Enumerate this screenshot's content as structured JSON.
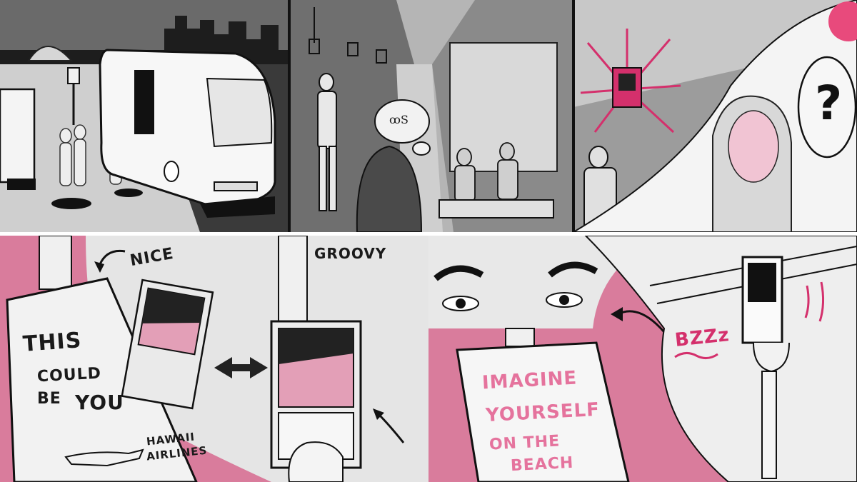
{
  "colors": {
    "accent_pink": "#d4306c",
    "soft_pink": "#e18aa8",
    "ink": "#1a1a1a",
    "light_gray": "#d9d9d9",
    "mid_gray": "#9a9a9a",
    "dark_gray": "#5c5c5c"
  },
  "panels": {
    "bus_stop": {
      "icon": "bus-icon"
    },
    "subway": {
      "thought_doodle": "ꝏS"
    },
    "screen_reveal": {
      "question": "?"
    },
    "hawaii_ad": {
      "line1": "THIS",
      "line2": "COULD",
      "line3": "BE",
      "emphasis": "YOU",
      "airline_line1": "HAWAII",
      "airline_line2": "AIRLINES"
    },
    "screens_compare": {
      "label_left": "NICE",
      "label_right": "GROOVY",
      "arrow_icon": "double-arrow-icon"
    },
    "beach_ad": {
      "line1": "IMAGINE",
      "line2": "YOURSELF",
      "line3": "ON THE",
      "line4": "BEACH"
    },
    "buzz": {
      "sound": "BZZz"
    }
  }
}
